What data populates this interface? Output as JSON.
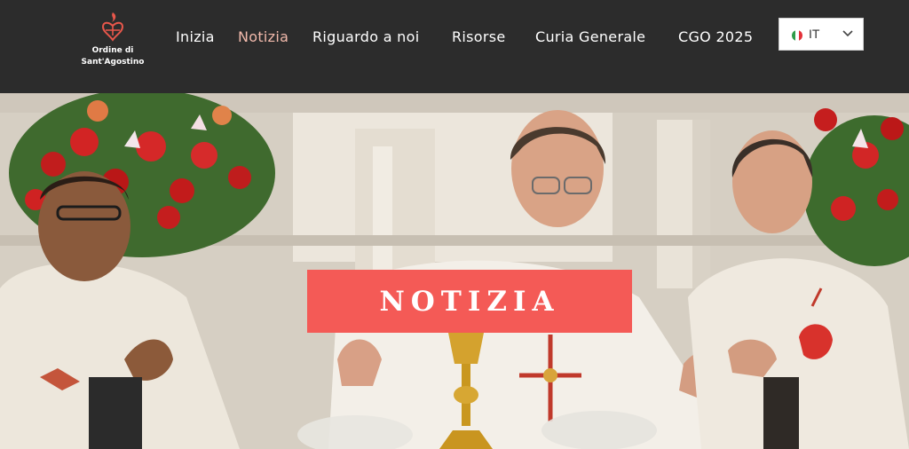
{
  "header": {
    "logo_lines": [
      "Ordine di",
      "Sant'Agostino"
    ],
    "nav": [
      {
        "label": "Inizia",
        "active": false
      },
      {
        "label": "Notizia",
        "active": true
      },
      {
        "label": "Riguardo a noi",
        "active": false
      },
      {
        "label": "Risorse",
        "active": false
      },
      {
        "label": "Curia Generale",
        "active": false
      },
      {
        "label": "CGO 2025",
        "active": false
      }
    ],
    "language": {
      "code": "IT",
      "flag_icon": "italy-flag-icon",
      "dropdown_icon": "chevron-down-icon"
    }
  },
  "hero": {
    "banner_title": "NOTIZIA",
    "image_alt": "photo of three priests celebrating mass at an altar with red flowers"
  },
  "colors": {
    "header_bg": "#2c2c2c",
    "nav_text": "#ffffff",
    "nav_active": "#f1b9ab",
    "banner_bg": "#f45a56",
    "logo_accent": "#e8574b"
  }
}
